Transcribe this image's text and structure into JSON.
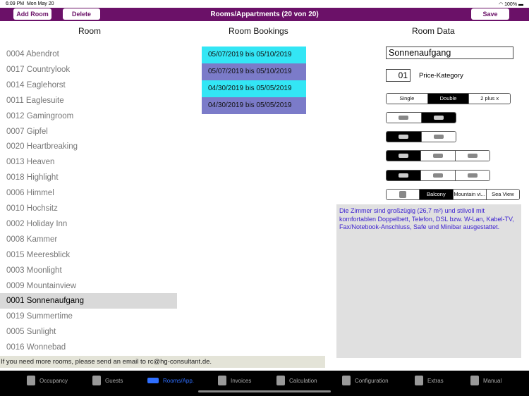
{
  "status": {
    "time": "6:09 PM",
    "date": "Mon May 20",
    "battery": "100%"
  },
  "header": {
    "add_room": "Add Room",
    "delete": "Delete",
    "title": "Rooms/Appartments (20 von 20)",
    "save": "Save",
    "color": "#6b1168"
  },
  "columns": {
    "room": "Room",
    "bookings": "Room Bookings",
    "data": "Room Data"
  },
  "rooms": [
    "0004 Abendrot",
    "0017 Countrylook",
    "0014 Eaglehorst",
    "0011 Eaglesuite",
    "0012 Gamingroom",
    "0007 Gipfel",
    "0020 Heartbreaking",
    "0013 Heaven",
    "0018 Highlight",
    "0006 Himmel",
    "0010 Hochsitz",
    "0002 Holiday Inn",
    "0008 Kammer",
    "0015 Meeresblick",
    "0003 Moonlight",
    "0009 Mountainview",
    "0001 Sonnenaufgang",
    "0019 Summertime",
    "0005 Sunlight",
    "0016 Wonnebad"
  ],
  "selected_room": "0001 Sonnenaufgang",
  "bookings": [
    {
      "text": "05/07/2019  bis  05/10/2019",
      "color": "#33e6f5"
    },
    {
      "text": "05/07/2019  bis  05/10/2019",
      "color": "#7b7bc9"
    },
    {
      "text": "04/30/2019  bis  05/05/2019",
      "color": "#33e6f5"
    },
    {
      "text": "04/30/2019  bis  05/05/2019",
      "color": "#7b7bc9"
    }
  ],
  "room_data": {
    "name": "Sonnenaufgang",
    "price_category": "01",
    "price_label": "Price-Kategory",
    "bed_types": [
      "Single",
      "Double",
      "2 plus x"
    ],
    "views": [
      "Balcony",
      "Mountain vi...",
      "Sea View"
    ],
    "description": "Die Zimmer sind großzügig (26,7 m²) und stilvoll mit komfortablen Doppelbett, Telefon, DSL bzw. W-Lan, Kabel-TV, Fax/Notebook-Anschluss, Safe und Minibar ausgestattet."
  },
  "footer_msg": "If you need more rooms, please send an email to rc@hg-consultant.de.",
  "tabs": [
    "Occupancy",
    "Guests",
    "Rooms/App.",
    "Invoices",
    "Calculation",
    "Configuration",
    "Extras",
    "Manual"
  ]
}
